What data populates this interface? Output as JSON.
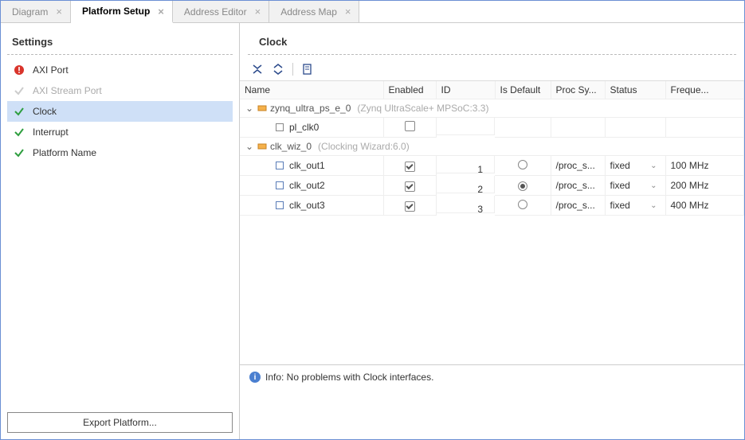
{
  "tabs": [
    {
      "label": "Diagram",
      "active": false
    },
    {
      "label": "Platform Setup",
      "active": true
    },
    {
      "label": "Address Editor",
      "active": false
    },
    {
      "label": "Address Map",
      "active": false
    }
  ],
  "left": {
    "header": "Settings",
    "items": [
      {
        "label": "AXI Port",
        "status": "error"
      },
      {
        "label": "AXI Stream Port",
        "status": "muted"
      },
      {
        "label": "Clock",
        "status": "ok",
        "selected": true
      },
      {
        "label": "Interrupt",
        "status": "ok"
      },
      {
        "label": "Platform Name",
        "status": "ok"
      }
    ],
    "export_btn": "Export Platform..."
  },
  "right": {
    "header": "Clock",
    "columns": [
      "Name",
      "Enabled",
      "ID",
      "Is Default",
      "Proc Sy...",
      "Status",
      "Freque..."
    ],
    "groups": [
      {
        "name": "zynq_ultra_ps_e_0",
        "meta": "(Zynq UltraScale+ MPSoC:3.3)",
        "children": [
          {
            "name": "pl_clk0",
            "enabled": false,
            "id": "",
            "is_default": "",
            "proc": "",
            "status": "",
            "freq": ""
          }
        ]
      },
      {
        "name": "clk_wiz_0",
        "meta": "(Clocking Wizard:6.0)",
        "children": [
          {
            "name": "clk_out1",
            "enabled": true,
            "id": "1",
            "is_default": false,
            "proc": "/proc_s...",
            "status": "fixed",
            "freq": "100 MHz"
          },
          {
            "name": "clk_out2",
            "enabled": true,
            "id": "2",
            "is_default": true,
            "proc": "/proc_s...",
            "status": "fixed",
            "freq": "200 MHz"
          },
          {
            "name": "clk_out3",
            "enabled": true,
            "id": "3",
            "is_default": false,
            "proc": "/proc_s...",
            "status": "fixed",
            "freq": "400 MHz"
          }
        ]
      }
    ],
    "info": "Info: No problems with Clock interfaces."
  }
}
